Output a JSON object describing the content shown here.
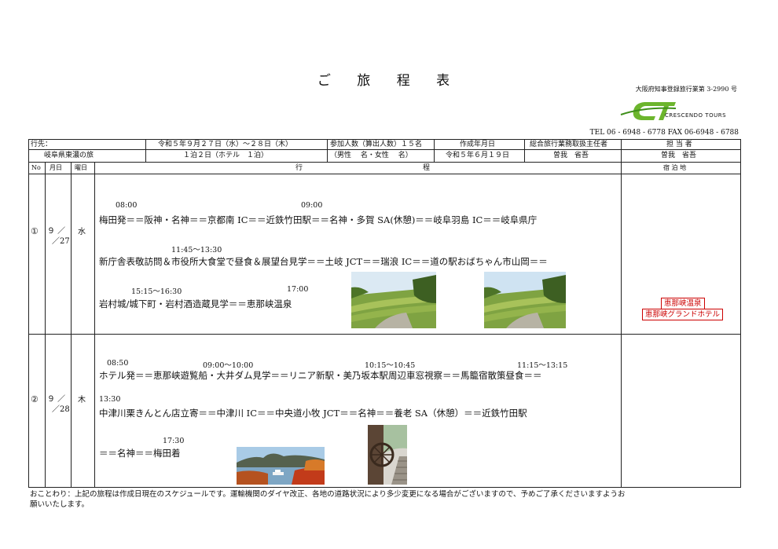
{
  "header": {
    "title": "ご 旅 程 表",
    "license": "大阪府知事登録旅行業第 3-2990 号",
    "logo_mark": "CT",
    "logo_name": "CRESCENDO TOURS",
    "contact": "TEL 06 - 6948 - 6778   FAX 06-6948 - 6788"
  },
  "info": {
    "dest_label": "行先：",
    "dest_value": "岐阜県東濃の旅",
    "dates": "令和５年９月２７日（水）～２８日（木）",
    "nights": "１泊２日（ホテル　１泊）",
    "participants": "参加人数（算出人数）１５名",
    "gender": "（男性　 名・女性　 名）",
    "created_label": "作成年月日",
    "created_value": "令和５年６月１９日",
    "manager_label": "総合旅行業務取扱主任者",
    "manager_value": "曽我　省吾",
    "staff_label": "担 当 者",
    "staff_value": "曽我　省吾"
  },
  "columns": {
    "no": "No",
    "date": "月日",
    "weekday": "曜日",
    "itinerary": "行　　　　　　　　　　　　　　　　　程",
    "lodging": "宿 泊 地"
  },
  "days": [
    {
      "no": "①",
      "date_top": "９ ／",
      "date_bottom": "／27",
      "weekday": "水",
      "times": [
        "08:00",
        "09:00",
        "11:45～13:30",
        "15:15～16:30",
        "17:00"
      ],
      "lines": [
        "梅田発＝＝阪神・名神＝＝京都南 IC＝＝近鉄竹田駅＝＝名神・多賀 SA(休憩)＝＝岐阜羽島 IC＝＝岐阜県庁",
        "新庁舎表敬訪問＆市役所大食堂で昼食＆展望台見学＝＝土岐 JCT＝＝瑞浪 IC＝＝道の駅おばちゃん市山岡＝＝",
        "岩村城/城下町・岩村酒造蔵見学＝＝恵那峡温泉"
      ],
      "lodging": [
        "恵那峡温泉",
        "恵那峡グランドホテル"
      ]
    },
    {
      "no": "②",
      "date_top": "９ ／",
      "date_bottom": "／28",
      "weekday": "木",
      "times": [
        "08:50",
        "09:00～10:00",
        "10:15～10:45",
        "11:15～13:15",
        "13:30",
        "17:30"
      ],
      "lines": [
        "ホテル発＝＝恵那峡遊覧船・大井ダム見学＝＝リニア新駅・美乃坂本駅周辺車窓視察＝＝馬籠宿散策昼食＝＝",
        "中津川栗きんとん店立寄＝＝中津川 IC＝＝中央道小牧 JCT＝＝名神＝＝養老 SA（休憩）＝＝近鉄竹田駅",
        "＝＝名神＝＝梅田着"
      ]
    }
  ],
  "note": "おことわり：上記の旅程は作成日現在のスケジュールです。運輸機関のダイヤ改正、各地の道路状況により多少変更になる場合がございますので、予めご了承くださいますようお願いいたします。",
  "colors": {
    "logo_green": "#6cb52d",
    "hotel_red": "#cc0000"
  }
}
